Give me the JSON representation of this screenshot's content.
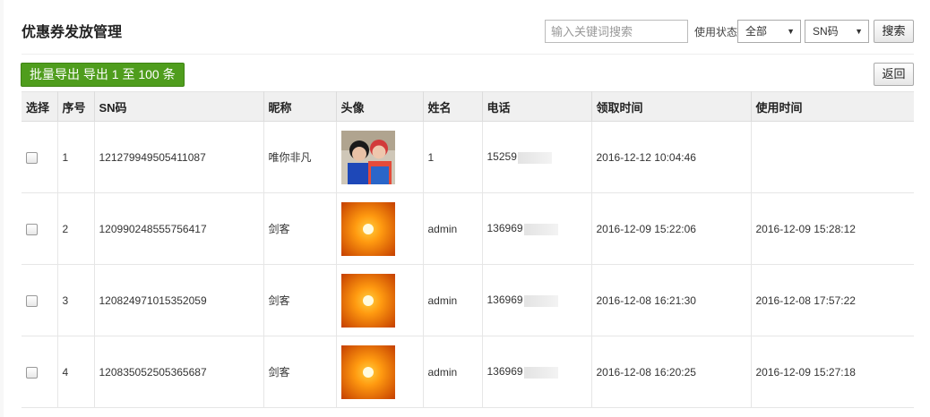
{
  "page": {
    "title": "优惠券发放管理"
  },
  "search": {
    "placeholder": "输入关键词搜索",
    "status_label": "使用状态",
    "status_selected": "全部",
    "field_selected": "SN码",
    "button_label": "搜索"
  },
  "toolbar": {
    "export_label": "批量导出 导出 1 至 100 条",
    "back_label": "返回"
  },
  "table": {
    "headers": [
      "选择",
      "序号",
      "SN码",
      "昵称",
      "头像",
      "姓名",
      "电话",
      "领取时间",
      "使用时间"
    ],
    "rows": [
      {
        "index": "1",
        "sn": "121279949505411087",
        "nickname": "唯你非凡",
        "avatar": "photo-avatar",
        "name": "1",
        "phone": "15259",
        "received": "2016-12-12 10:04:46",
        "used": ""
      },
      {
        "index": "2",
        "sn": "120990248555756417",
        "nickname": "剑客",
        "avatar": "sun-avatar",
        "name": "admin",
        "phone": "136969",
        "received": "2016-12-09 15:22:06",
        "used": "2016-12-09 15:28:12"
      },
      {
        "index": "3",
        "sn": "120824971015352059",
        "nickname": "剑客",
        "avatar": "sun-avatar",
        "name": "admin",
        "phone": "136969",
        "received": "2016-12-08 16:21:30",
        "used": "2016-12-08 17:57:22"
      },
      {
        "index": "4",
        "sn": "120835052505365687",
        "nickname": "剑客",
        "avatar": "sun-avatar",
        "name": "admin",
        "phone": "136969",
        "received": "2016-12-08 16:20:25",
        "used": "2016-12-09 15:27:18"
      }
    ]
  },
  "colors": {
    "export_button": "#4f9d1d",
    "header_bg": "#f0f0f0",
    "avatar_sun": "#ff8c00"
  }
}
